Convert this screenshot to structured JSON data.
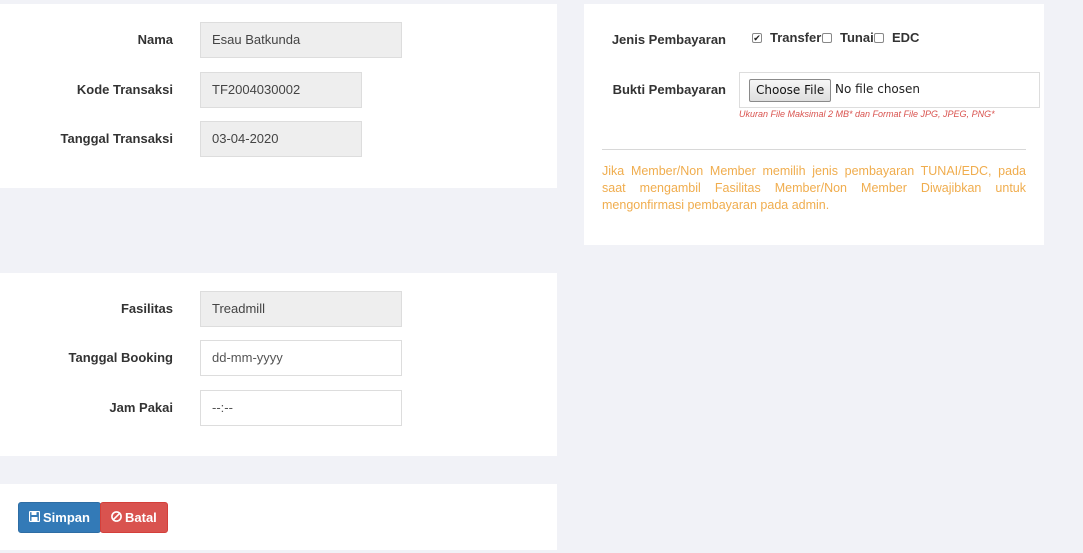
{
  "identity": {
    "nama_label": "Nama",
    "nama_value": "Esau Batkunda",
    "kode_label": "Kode Transaksi",
    "kode_value": "TF2004030002",
    "tanggal_label": "Tanggal Transaksi",
    "tanggal_value": "03-04-2020"
  },
  "booking": {
    "fasilitas_label": "Fasilitas",
    "fasilitas_value": "Treadmill",
    "tanggal_label": "Tanggal Booking",
    "tanggal_value": "dd-mm-yyyy",
    "jam_label": "Jam Pakai",
    "jam_value": "--:--"
  },
  "payment": {
    "jenis_label": "Jenis Pembayaran",
    "options": [
      {
        "label": "Transfer",
        "checked": true
      },
      {
        "label": "Tunai",
        "checked": false
      },
      {
        "label": "EDC",
        "checked": false
      }
    ],
    "bukti_label": "Bukti Pembayaran",
    "file_button": "Choose File",
    "file_status": "No file chosen",
    "file_hint": "Ukuran File Maksimal 2 MB* dan Format File JPG, JPEG, PNG*",
    "notice": "Jika Member/Non Member memilih jenis pembayaran TUNAI/EDC, pada saat mengambil Fasilitas Member/Non Member Diwajibkan untuk mengonfirmasi pembayaran pada admin."
  },
  "actions": {
    "save_label": "Simpan",
    "cancel_label": "Batal",
    "save_icon": "floppy-disk-icon",
    "cancel_icon": "ban-icon"
  },
  "colors": {
    "primary": "#337ab7",
    "danger": "#d9534f",
    "warning": "#f0ad4e",
    "readonly_bg": "#eeeeee"
  }
}
